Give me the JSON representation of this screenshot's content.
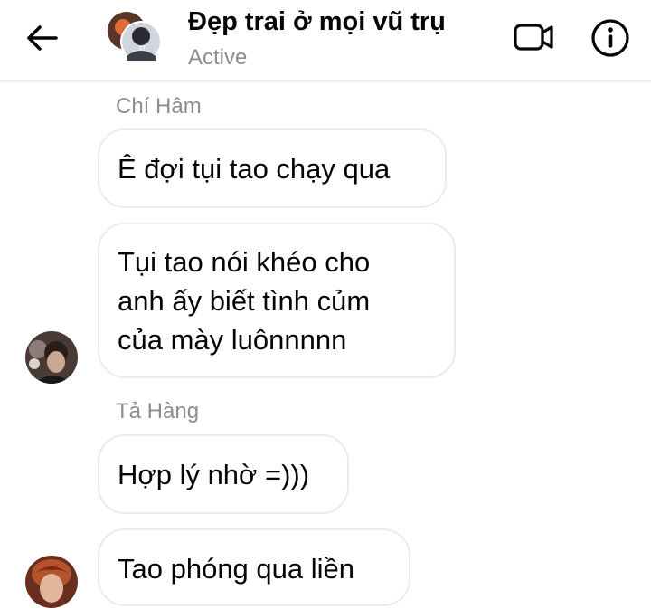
{
  "header": {
    "title": "Đẹp trai ở mọi vũ trụ",
    "status": "Active",
    "back_icon": "arrow-left-icon",
    "video_icon": "video-camera-icon",
    "info_icon": "info-icon",
    "avatar": "group-avatar"
  },
  "messages": [
    {
      "sender": "Chí Hâm",
      "lines": [
        "Ê đợi tụi tao chạy qua"
      ]
    },
    {
      "sender": "",
      "lines": [
        "Tụi tao nói khéo cho",
        "anh ấy biết tình củm",
        "của mày luônnnnn"
      ]
    },
    {
      "sender": "Tả Hàng",
      "lines": [
        "Hợp lý nhờ =)))"
      ]
    },
    {
      "sender": "",
      "lines": [
        "Tao phóng qua liền"
      ]
    }
  ],
  "colors": {
    "background": "#ffffff",
    "text": "#050505",
    "secondary_text": "#8a8d91",
    "bubble_border": "#ececec"
  }
}
